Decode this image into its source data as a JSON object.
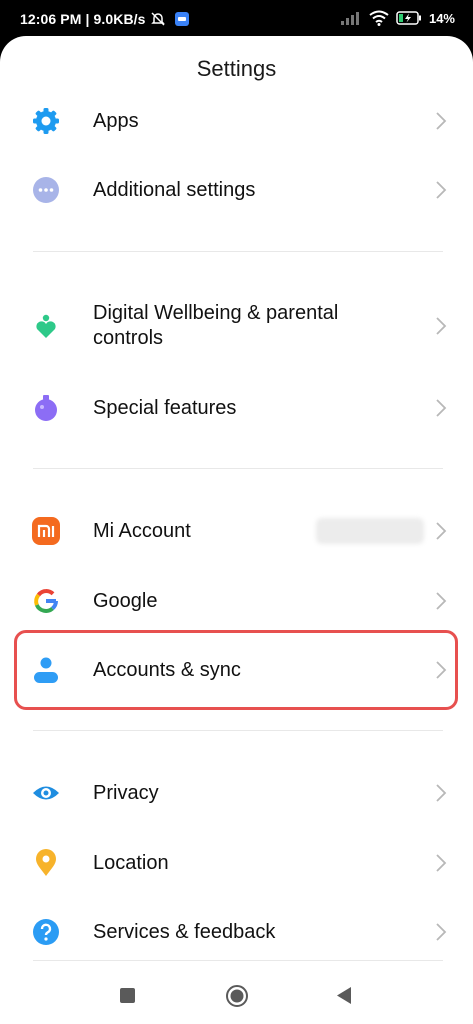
{
  "status_bar": {
    "time": "12:06 PM | 9.0KB/s",
    "battery": "14%"
  },
  "page_title": "Settings",
  "colors": {
    "apps_icon": "#1e9bf0",
    "additional_icon": "#a8b4e8",
    "wellbeing_icon": "#2ec989",
    "special_icon": "#8c6df5",
    "mi_icon": "#f46a1f",
    "accounts_icon": "#2f9df5",
    "privacy_icon": "#1f8de0",
    "location_icon": "#f7b32b",
    "services_icon": "#2b9cf4",
    "highlight": "#e7504f"
  },
  "items": {
    "apps": {
      "label": "Apps",
      "icon": "gear-icon"
    },
    "additional": {
      "label": "Additional settings",
      "icon": "more-dots-icon"
    },
    "wellbeing": {
      "label_line1": "Digital Wellbeing & parental",
      "label_line2": "controls",
      "icon": "wellbeing-icon"
    },
    "special": {
      "label": "Special features",
      "icon": "flask-icon"
    },
    "mi_account": {
      "label": "Mi Account",
      "icon": "mi-logo-icon"
    },
    "google": {
      "label": "Google",
      "icon": "google-logo-icon"
    },
    "accounts": {
      "label": "Accounts & sync",
      "icon": "person-icon"
    },
    "privacy": {
      "label": "Privacy",
      "icon": "eye-icon"
    },
    "location": {
      "label": "Location",
      "icon": "location-pin-icon"
    },
    "services": {
      "label": "Services & feedback",
      "icon": "question-icon"
    }
  }
}
